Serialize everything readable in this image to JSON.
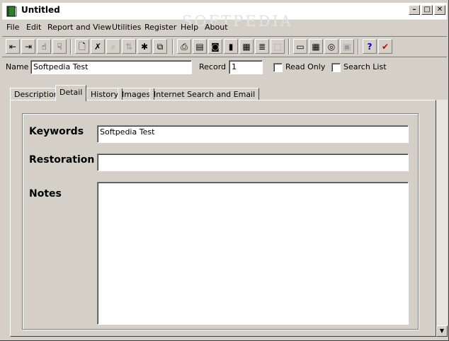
{
  "window": {
    "title": "Untitled",
    "watermark": "SOFTPEDIA"
  },
  "title_buttons": {
    "minimize": "–",
    "maximize": "□",
    "close": "✕"
  },
  "menu": [
    "File",
    "Edit",
    "Report and View",
    "Utilities",
    "Register",
    "Help",
    "About"
  ],
  "toolbar": {
    "buttons": [
      {
        "icon": "first-record-icon",
        "glyph": "⇤",
        "enabled": true
      },
      {
        "icon": "last-record-icon",
        "glyph": "⇥",
        "enabled": true
      },
      {
        "icon": "previous-record-icon",
        "glyph": "☝",
        "enabled": true
      },
      {
        "icon": "next-record-icon",
        "glyph": "☟",
        "enabled": true
      },
      {
        "icon": "new-record-icon",
        "glyph": "🗋",
        "enabled": true
      },
      {
        "icon": "delete-record-icon",
        "glyph": "✗",
        "enabled": true
      },
      {
        "icon": "find-icon",
        "glyph": "⌕",
        "enabled": false
      },
      {
        "icon": "sort-icon",
        "glyph": "⇅",
        "enabled": false
      },
      {
        "icon": "clear-icon",
        "glyph": "✱",
        "enabled": true
      },
      {
        "icon": "copy-icon",
        "glyph": "⧉",
        "enabled": true
      },
      {
        "icon": "print-icon",
        "glyph": "⎙",
        "enabled": true
      },
      {
        "icon": "print-preview-icon",
        "glyph": "▤",
        "enabled": true
      },
      {
        "icon": "camera-icon",
        "glyph": "◙",
        "enabled": true
      },
      {
        "icon": "chart-icon",
        "glyph": "▮",
        "enabled": true
      },
      {
        "icon": "table-icon",
        "glyph": "▦",
        "enabled": true
      },
      {
        "icon": "list-report-icon",
        "glyph": "≣",
        "enabled": true
      },
      {
        "icon": "label-icon",
        "glyph": "⬚",
        "enabled": false
      },
      {
        "icon": "calculator-icon",
        "glyph": "▭",
        "enabled": true
      },
      {
        "icon": "calendar-icon",
        "glyph": "▦",
        "enabled": true
      },
      {
        "icon": "cd-icon",
        "glyph": "◎",
        "enabled": true
      },
      {
        "icon": "save-icon",
        "glyph": "▣",
        "enabled": false
      },
      {
        "icon": "help-icon",
        "glyph": "?",
        "enabled": true
      },
      {
        "icon": "check-icon",
        "glyph": "✔",
        "enabled": true
      }
    ]
  },
  "fields": {
    "name_label": "Name",
    "name_value": "Softpedia Test",
    "record_label": "Record",
    "record_value": "1",
    "read_only_label": "Read Only",
    "search_list_label": "Search List"
  },
  "tabs": [
    "Description",
    "Detail",
    "History",
    "Images",
    "Internet Search and Email"
  ],
  "active_tab": "Detail",
  "detail": {
    "keywords_label": "Keywords",
    "keywords_value": "Softpedia Test",
    "restoration_label": "Restoration",
    "restoration_value": "",
    "notes_label": "Notes",
    "notes_value": ""
  },
  "scrollbar": {
    "down_arrow": "▼"
  },
  "colors": {
    "face": "#d4d0c8",
    "icon_book": "#2e7d32",
    "help": "#0000c0",
    "check": "#d00000"
  }
}
